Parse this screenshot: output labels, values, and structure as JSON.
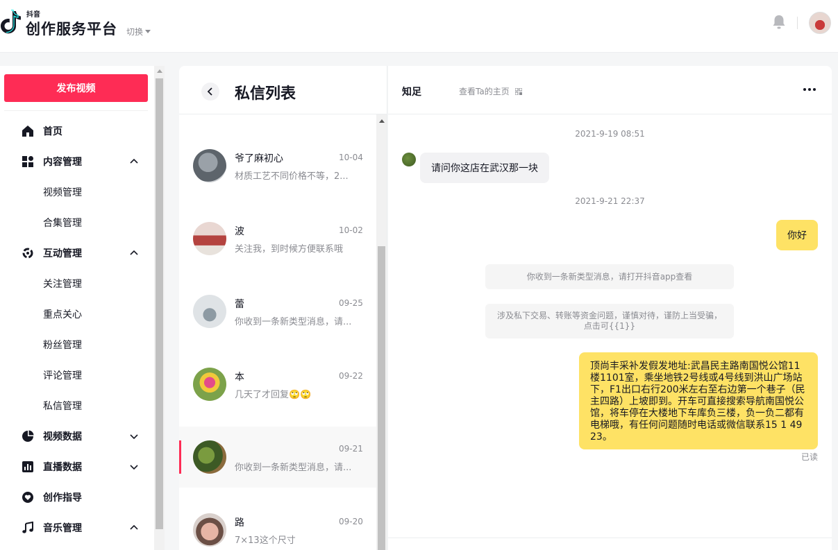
{
  "header": {
    "brand_top": "抖音",
    "brand_main": "创作服务平台",
    "switch_label": "切换"
  },
  "sidebar": {
    "publish_label": "发布视频",
    "items": [
      {
        "label": "首页",
        "icon": "home-icon"
      },
      {
        "label": "内容管理",
        "icon": "content-icon",
        "expanded": true,
        "children": [
          "视频管理",
          "合集管理"
        ]
      },
      {
        "label": "互动管理",
        "icon": "interaction-icon",
        "expanded": true,
        "children": [
          "关注管理",
          "重点关心",
          "粉丝管理",
          "评论管理",
          "私信管理"
        ]
      },
      {
        "label": "视频数据",
        "icon": "pie-chart-icon",
        "expanded": false
      },
      {
        "label": "直播数据",
        "icon": "bar-chart-icon",
        "expanded": false
      },
      {
        "label": "创作指导",
        "icon": "heart-icon"
      },
      {
        "label": "音乐管理",
        "icon": "music-note-icon",
        "expanded": true
      }
    ]
  },
  "message_list": {
    "title": "私信列表",
    "conversations": [
      {
        "name": "爷了麻初心",
        "date": "10-04",
        "snippet": "材质工艺不同价格不等，2..."
      },
      {
        "name": "波",
        "date": "10-02",
        "snippet": "关注我，到时候方便联系哦"
      },
      {
        "name": "蕾",
        "date": "09-25",
        "snippet": "你收到一条新类型消息，请..."
      },
      {
        "name": "本",
        "date": "09-22",
        "snippet": "几天了才回复🙄🙄"
      },
      {
        "name": "",
        "date": "09-21",
        "snippet": "你收到一条新类型消息，请...",
        "active": true
      },
      {
        "name": "路",
        "date": "09-20",
        "snippet": "7×13这个尺寸"
      }
    ]
  },
  "chat": {
    "contact_name": "知足",
    "view_home_label": "查看Ta的主页",
    "messages": [
      {
        "type": "time",
        "text": "2021-9-19 08:51"
      },
      {
        "type": "in",
        "text": "请问你这店在武汉那一块"
      },
      {
        "type": "time",
        "text": "2021-9-21 22:37"
      },
      {
        "type": "out",
        "text": "你好"
      },
      {
        "type": "system",
        "text": "你收到一条新类型消息，请打开抖音app查看"
      },
      {
        "type": "system",
        "text": "涉及私下交易、转账等资金问题，谨慎对待，谨防上当受骗，点击可{{1}}"
      },
      {
        "type": "out",
        "text": "顶尚丰采补发假发地址:武昌民主路南国悦公馆11楼1101室，乘坐地铁2号线或4号线到洪山广场站下，F1出口右行200米左右至右边第一个巷子（民主四路）上坡即到。开车可直接搜索导航南国悦公馆，将车停在大楼地下车库负三楼，负一负二都有电梯哦，有任何问题随时电话或微信联系15   1 4923。"
      }
    ],
    "read_status": "已读"
  },
  "colors": {
    "accent": "#fe2c55",
    "bubble_out": "#fee265",
    "bubble_in": "#f2f2f4"
  }
}
